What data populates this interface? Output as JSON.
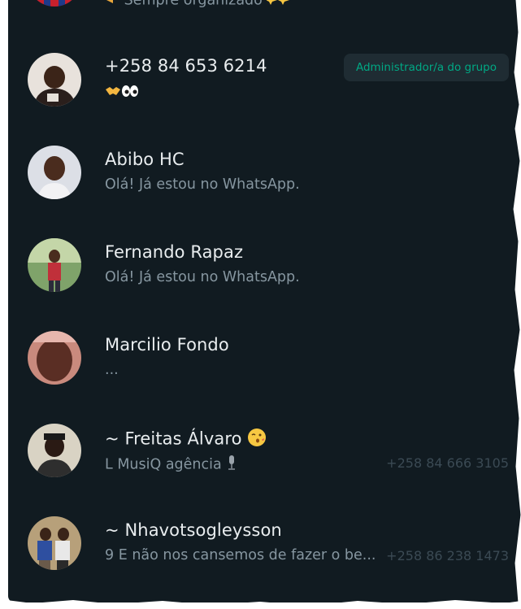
{
  "participants": [
    {
      "status": "Sempre organizado"
    },
    {
      "name": "+258 84 653 6214",
      "status_emoji": [
        "handshake-emoji",
        "eyes-emoji"
      ],
      "badge": "Administrador/a do grupo"
    },
    {
      "name": "Abibo HC",
      "status": "Olá! Já estou no WhatsApp."
    },
    {
      "name": "Fernando Rapaz",
      "status": "Olá! Já estou no WhatsApp."
    },
    {
      "name": "Marcilio Fondo",
      "status": "..."
    },
    {
      "name": "~ Freitas Álvaro",
      "name_emoji": "wink-kiss-emoji",
      "status": "L MusiQ agência",
      "status_emoji": "microphone-emoji",
      "phone": "+258 84 666 3105"
    },
    {
      "name": "~ Nhavotsogleysson",
      "status": "9 E não nos cansemos de fazer o be...",
      "phone": "+258 86 238 1473"
    }
  ],
  "colors": {
    "background": "#111b21",
    "name_text": "#e9edef",
    "secondary_text": "#8696a0",
    "dim_phone_text": "#3b4a54",
    "admin_accent": "#00a884",
    "badge_background": "#1f2c33"
  }
}
